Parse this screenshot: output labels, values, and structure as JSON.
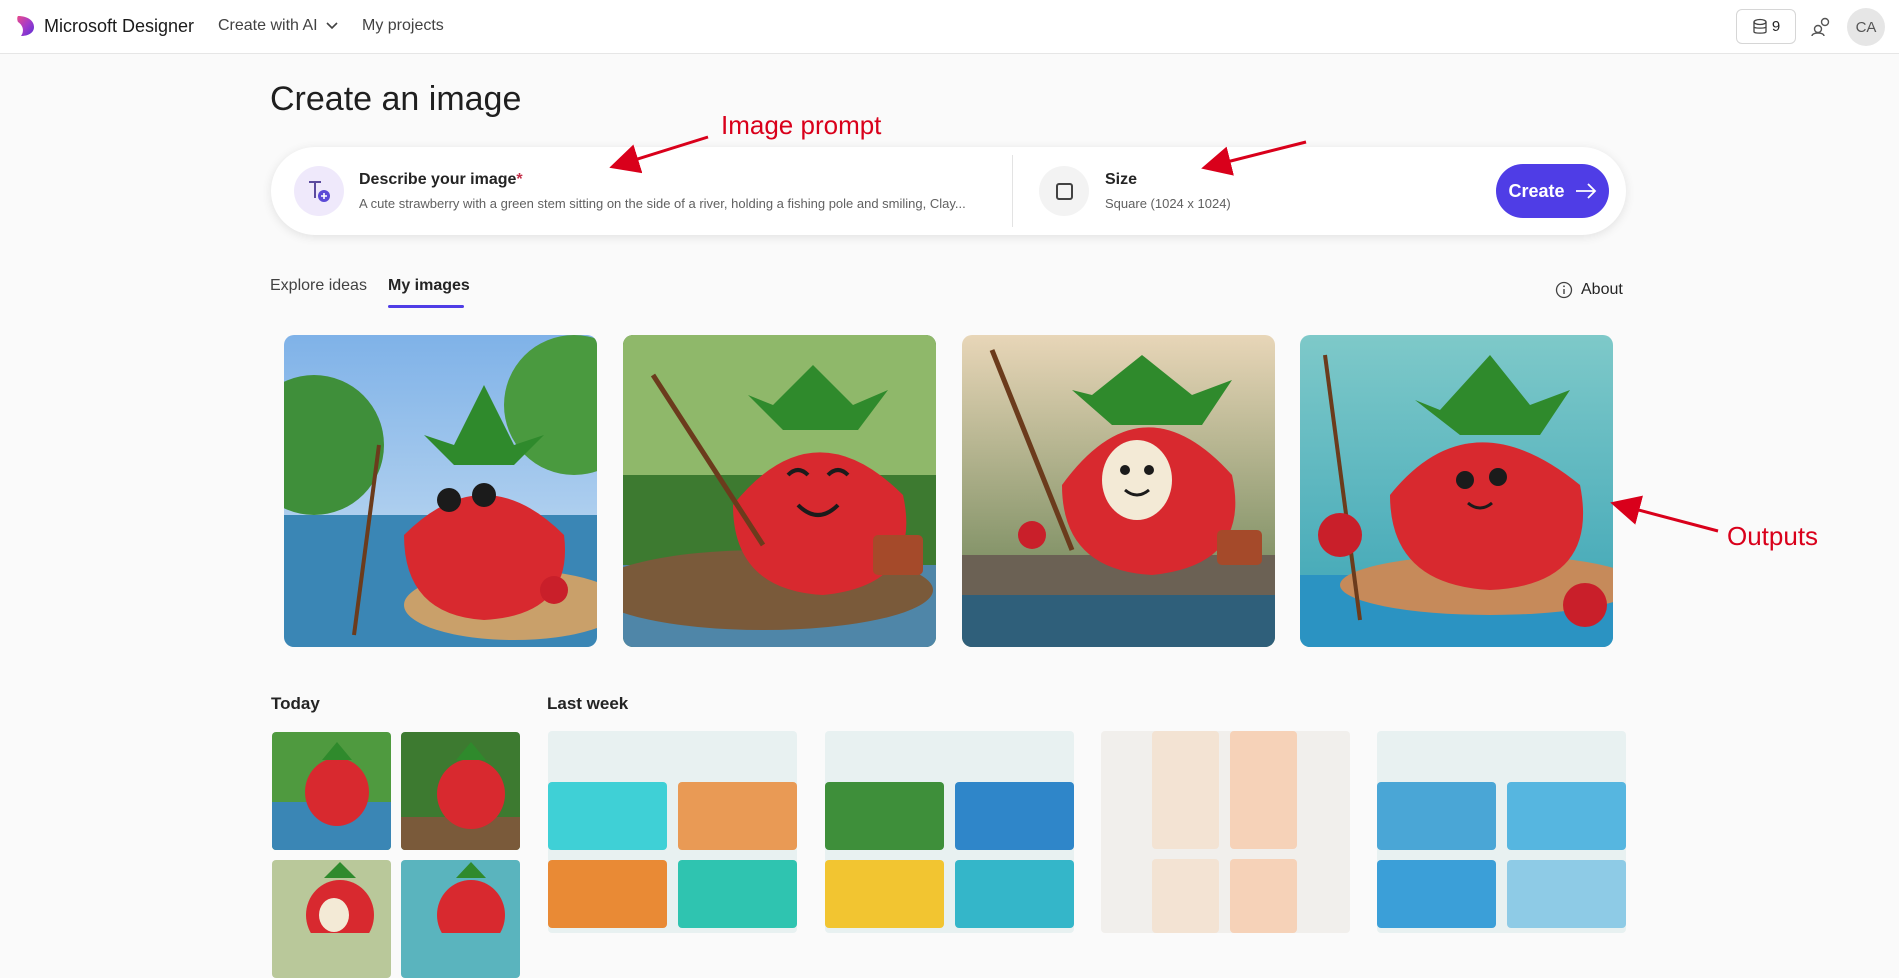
{
  "app": {
    "name": "Microsoft Designer"
  },
  "nav": {
    "create_with_ai": "Create with AI",
    "my_projects": "My projects"
  },
  "header": {
    "credits": "9",
    "avatar_initials": "CA"
  },
  "page": {
    "title": "Create an image"
  },
  "prompt": {
    "label": "Describe your image",
    "required_mark": "*",
    "value": "A cute strawberry with a green stem sitting on the side of a river, holding a fishing pole and smiling, Clay..."
  },
  "size": {
    "label": "Size",
    "value": "Square (1024 x 1024)"
  },
  "create_button": {
    "label": "Create"
  },
  "tabs": [
    {
      "label": "Explore ideas",
      "active": false
    },
    {
      "label": "My images",
      "active": true
    }
  ],
  "about": {
    "label": "About"
  },
  "annotations": {
    "image_prompt": "Image prompt",
    "outputs": "Outputs"
  },
  "history": {
    "today": "Today",
    "last_week": "Last week"
  },
  "colors": {
    "accent": "#4f3de6",
    "annotation": "#d9001b",
    "required": "#c4314b"
  }
}
